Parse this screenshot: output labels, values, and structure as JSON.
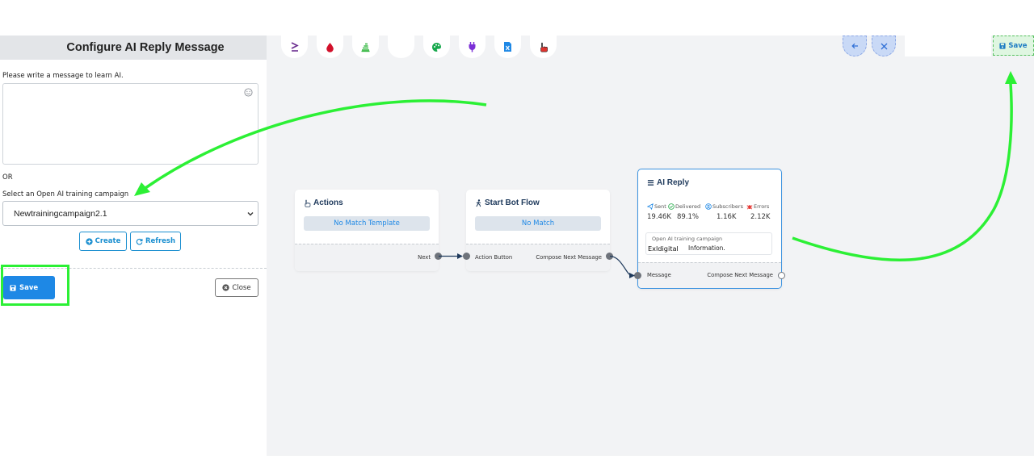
{
  "panel": {
    "title": "Configure AI Reply Message",
    "prompt_label": "Please write a message to learn AI.",
    "message_value": "",
    "or_label": "OR",
    "campaign_label": "Select an Open AI training campaign",
    "campaign_selected": "Newtrainingcampaign2.1",
    "create_label": "Create",
    "refresh_label": "Refresh",
    "save_label": "Save",
    "close_label": "Close"
  },
  "toolbar": {
    "tools": [
      "greater-equal-icon",
      "drop-icon",
      "stack-icon",
      "blank",
      "palette-icon",
      "plug-icon",
      "excel-file-icon",
      "pointer-hand-icon"
    ],
    "back_icon": "arrow-left-icon",
    "fit_icon": "expand-icon",
    "save_label": "Save"
  },
  "nodes": {
    "actions": {
      "title": "Actions",
      "pill": "No Match Template",
      "out_label": "Next"
    },
    "start_bot": {
      "title": "Start Bot Flow",
      "pill": "No Match",
      "in_label": "Action Button",
      "out_label": "Compose Next Message"
    },
    "ai_reply": {
      "title": "AI Reply",
      "stats": [
        {
          "label": "Sent",
          "value": "19.46K",
          "icon": "send-icon"
        },
        {
          "label": "Delivered",
          "value": "89.1%",
          "icon": "check-circle-icon"
        },
        {
          "label": "Subscribers",
          "value": "1.16K",
          "icon": "user-circle-icon"
        },
        {
          "label": "Errors",
          "value": "2.12K",
          "icon": "bug-icon"
        }
      ],
      "campaign_label": "Open AI training campaign",
      "campaign_brand": "Exldigital",
      "campaign_value": "Information.",
      "in_label": "Message",
      "out_label": "Compose Next Message"
    }
  },
  "colors": {
    "accent": "#1e88e5",
    "highlight": "#2cf035",
    "canvas": "#f2f3f5"
  }
}
